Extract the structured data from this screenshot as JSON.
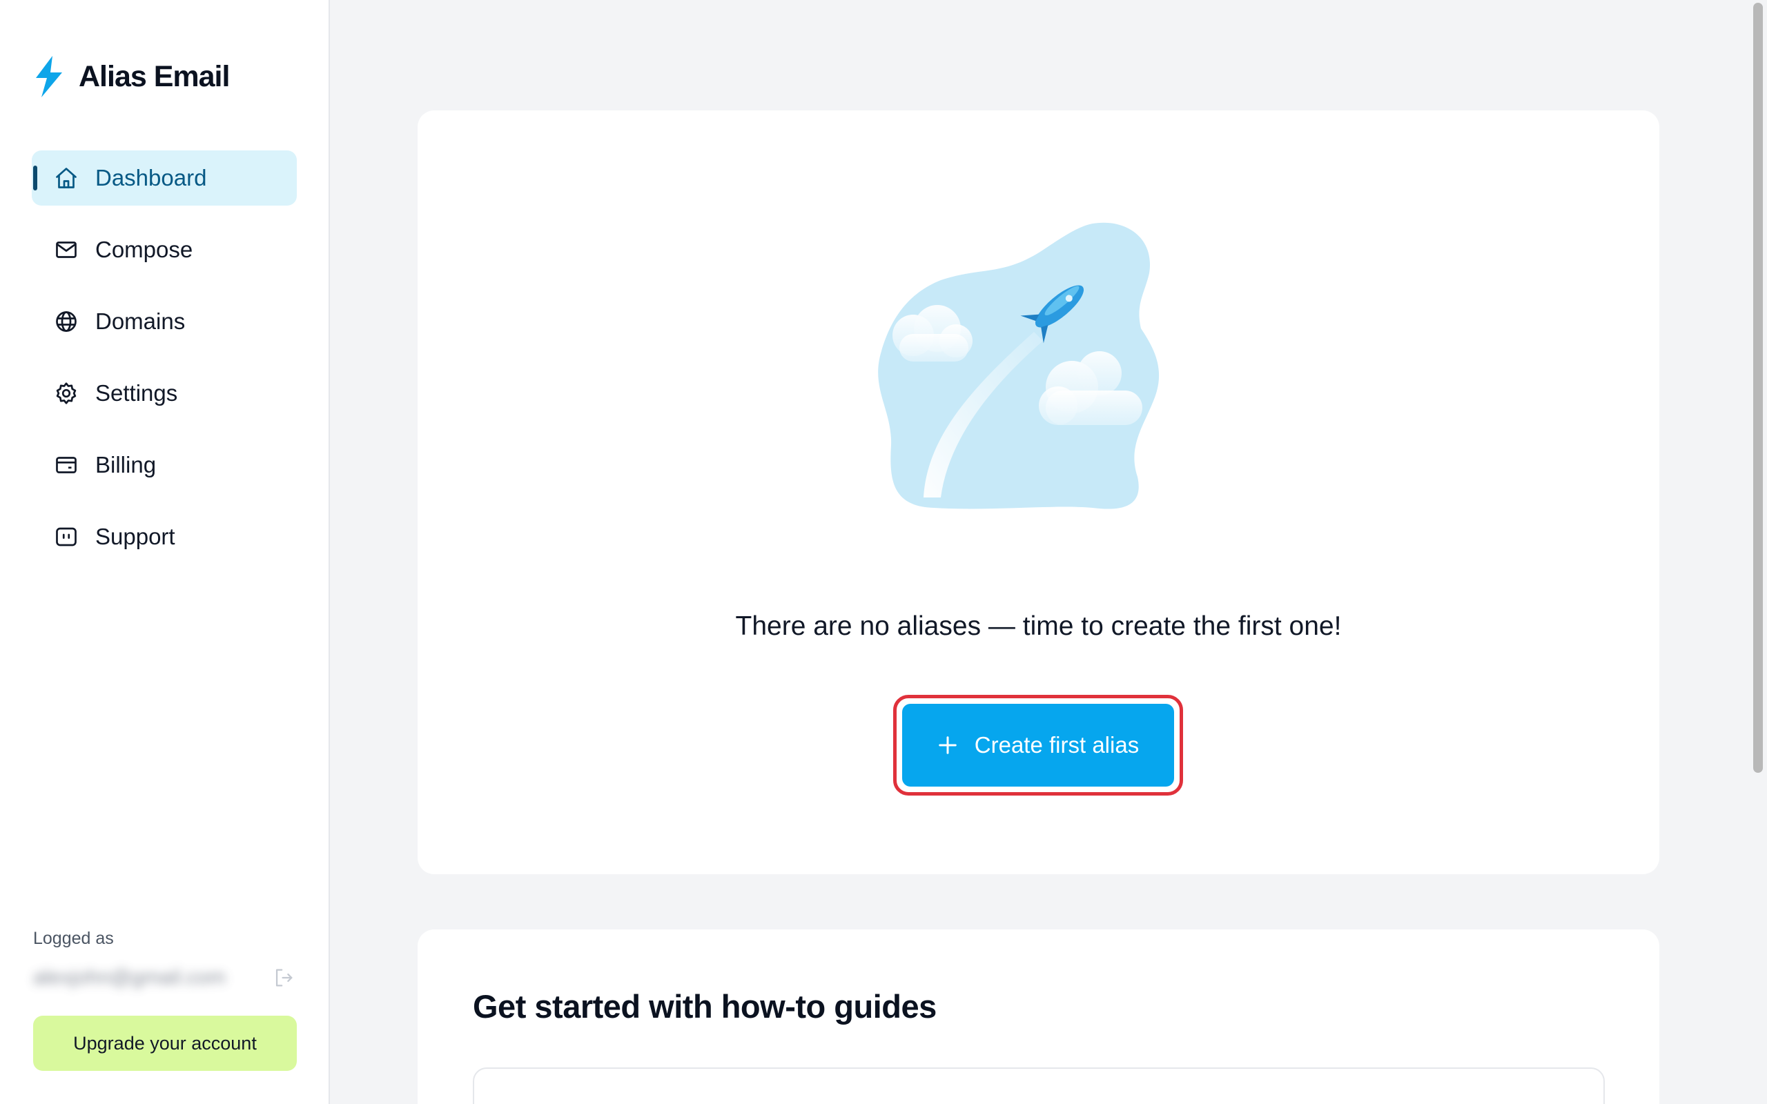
{
  "brand": {
    "name": "Alias Email",
    "accent": "#0ea5e9"
  },
  "nav": {
    "items": [
      {
        "label": "Dashboard",
        "icon": "home-icon",
        "active": true
      },
      {
        "label": "Compose",
        "icon": "mail-icon"
      },
      {
        "label": "Domains",
        "icon": "globe-icon"
      },
      {
        "label": "Settings",
        "icon": "gear-icon"
      },
      {
        "label": "Billing",
        "icon": "wallet-icon"
      },
      {
        "label": "Support",
        "icon": "chat-icon"
      }
    ]
  },
  "account": {
    "logged_label": "Logged as",
    "email": "alexjohn@gmail.com",
    "upgrade_label": "Upgrade your account"
  },
  "empty_state": {
    "message": "There are no aliases — time to create the first one!",
    "button_label": "Create first alias",
    "illustration": "rocket-illustration"
  },
  "guides": {
    "title": "Get started with how-to guides"
  },
  "colors": {
    "primary_button": "#06a6ee",
    "active_nav_bg": "#daf3fb",
    "upgrade_bg": "#d9f99d",
    "focus_ring": "#e0313b"
  }
}
